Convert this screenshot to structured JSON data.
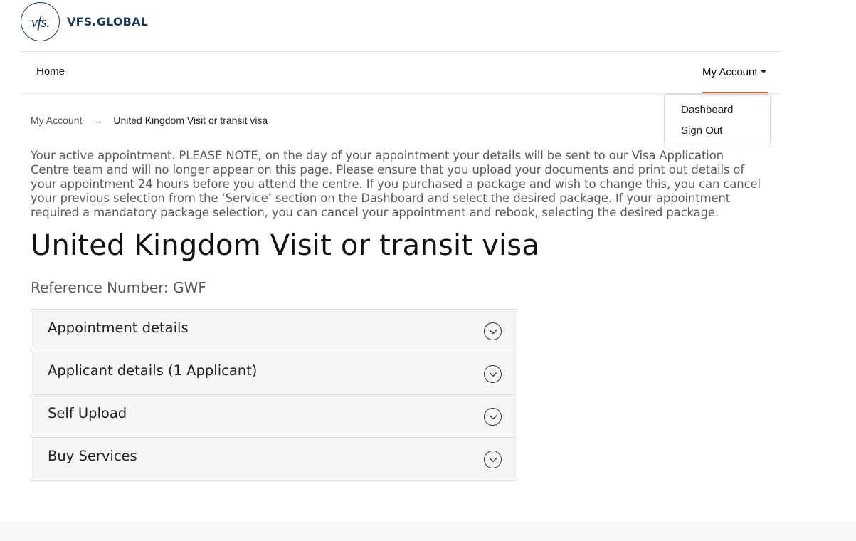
{
  "brand": {
    "logo_mark": "vfs.",
    "logo_text": "VFS.GLOBAL",
    "accent_color": "#e35b26",
    "brand_color": "#1e3a57"
  },
  "nav": {
    "home": "Home",
    "account": "My Account",
    "account_menu": [
      "Dashboard",
      "Sign Out"
    ]
  },
  "breadcrumb": {
    "parent": "My Account",
    "separator": "→",
    "current": "United Kingdom Visit or transit visa"
  },
  "notice": "Your active appointment. PLEASE NOTE, on the day of your appointment your details will be sent to our Visa Application Centre team and will no longer appear on this page. Please ensure that you upload your documents and print out details of your appointment 24 hours before you attend the centre. If you purchased a package and wish to change this, you can cancel your previous selection from the ‘Service’ section on the Dashboard and select the desired package. If your appointment required a mandatory package selection, you can cancel your appointment and rebook, selecting the desired package.",
  "page_title": "United Kingdom Visit or transit visa",
  "reference": "Reference Number: GWF",
  "accordion": [
    {
      "label": "Appointment details",
      "icon": "chevron-down-circle-icon"
    },
    {
      "label": "Applicant details (1 Applicant)",
      "icon": "chevron-down-circle-icon"
    },
    {
      "label": "Self Upload",
      "icon": "chevron-down-circle-icon"
    },
    {
      "label": "Buy Services",
      "icon": "chevron-down-circle-icon"
    }
  ]
}
